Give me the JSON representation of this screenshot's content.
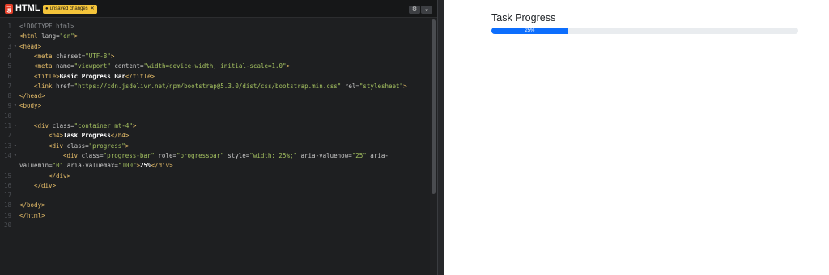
{
  "editor": {
    "language_label": "HTML",
    "unsaved_label": "unsaved changes",
    "unsaved_close": "✕",
    "settings_icon": "⚙",
    "collapse_icon": "⌄",
    "lines": [
      {
        "n": "1",
        "fold": "",
        "indent": 0,
        "tokens": [
          {
            "t": "<!DOCTYPE html>",
            "c": "doctype"
          }
        ]
      },
      {
        "n": "2",
        "fold": "",
        "indent": 0,
        "tokens": [
          {
            "t": "<",
            "c": "tag"
          },
          {
            "t": "html",
            "c": "tag"
          },
          {
            "t": " lang",
            "c": "attr"
          },
          {
            "t": "=",
            "c": "plain"
          },
          {
            "t": "\"en\"",
            "c": "str"
          },
          {
            "t": ">",
            "c": "tag"
          }
        ]
      },
      {
        "n": "3",
        "fold": "▾",
        "indent": 0,
        "tokens": [
          {
            "t": "<head>",
            "c": "tag"
          }
        ]
      },
      {
        "n": "4",
        "fold": "",
        "indent": 1,
        "tokens": [
          {
            "t": "<meta",
            "c": "tag"
          },
          {
            "t": " charset",
            "c": "attr"
          },
          {
            "t": "=",
            "c": "plain"
          },
          {
            "t": "\"UTF-8\"",
            "c": "str"
          },
          {
            "t": ">",
            "c": "tag"
          }
        ]
      },
      {
        "n": "5",
        "fold": "",
        "indent": 1,
        "tokens": [
          {
            "t": "<meta",
            "c": "tag"
          },
          {
            "t": " name",
            "c": "attr"
          },
          {
            "t": "=",
            "c": "plain"
          },
          {
            "t": "\"viewport\"",
            "c": "str"
          },
          {
            "t": " content",
            "c": "attr"
          },
          {
            "t": "=",
            "c": "plain"
          },
          {
            "t": "\"width=device-width, initial-scale=1.0\"",
            "c": "str"
          },
          {
            "t": ">",
            "c": "tag"
          }
        ]
      },
      {
        "n": "6",
        "fold": "",
        "indent": 1,
        "tokens": [
          {
            "t": "<title>",
            "c": "tag"
          },
          {
            "t": "Basic Progress Bar",
            "c": "text"
          },
          {
            "t": "</title>",
            "c": "tag"
          }
        ]
      },
      {
        "n": "7",
        "fold": "",
        "indent": 1,
        "tokens": [
          {
            "t": "<link",
            "c": "tag"
          },
          {
            "t": " href",
            "c": "attr"
          },
          {
            "t": "=",
            "c": "plain"
          },
          {
            "t": "\"https://cdn.jsdelivr.net/npm/bootstrap@5.3.0/dist/css/bootstrap.min.css\"",
            "c": "str"
          },
          {
            "t": " rel",
            "c": "attr"
          },
          {
            "t": "=",
            "c": "plain"
          },
          {
            "t": "\"stylesheet\"",
            "c": "str"
          },
          {
            "t": ">",
            "c": "tag"
          }
        ]
      },
      {
        "n": "8",
        "fold": "",
        "indent": 0,
        "tokens": [
          {
            "t": "</head>",
            "c": "tag"
          }
        ]
      },
      {
        "n": "9",
        "fold": "▾",
        "indent": 0,
        "tokens": [
          {
            "t": "<body>",
            "c": "tag"
          }
        ]
      },
      {
        "n": "10",
        "fold": "",
        "indent": 0,
        "tokens": []
      },
      {
        "n": "11",
        "fold": "▾",
        "indent": 1,
        "tokens": [
          {
            "t": "<div",
            "c": "tag"
          },
          {
            "t": " class",
            "c": "attr"
          },
          {
            "t": "=",
            "c": "plain"
          },
          {
            "t": "\"container mt-4\"",
            "c": "str"
          },
          {
            "t": ">",
            "c": "tag"
          }
        ]
      },
      {
        "n": "12",
        "fold": "",
        "indent": 2,
        "tokens": [
          {
            "t": "<h4>",
            "c": "tag"
          },
          {
            "t": "Task Progress",
            "c": "text"
          },
          {
            "t": "</h4>",
            "c": "tag"
          }
        ]
      },
      {
        "n": "13",
        "fold": "▾",
        "indent": 2,
        "tokens": [
          {
            "t": "<div",
            "c": "tag"
          },
          {
            "t": " class",
            "c": "attr"
          },
          {
            "t": "=",
            "c": "plain"
          },
          {
            "t": "\"progress\"",
            "c": "str"
          },
          {
            "t": ">",
            "c": "tag"
          }
        ]
      },
      {
        "n": "14",
        "fold": "▾",
        "indent": 3,
        "tokens": [
          {
            "t": "<div",
            "c": "tag"
          },
          {
            "t": " class",
            "c": "attr"
          },
          {
            "t": "=",
            "c": "plain"
          },
          {
            "t": "\"progress-bar\"",
            "c": "str"
          },
          {
            "t": " role",
            "c": "attr"
          },
          {
            "t": "=",
            "c": "plain"
          },
          {
            "t": "\"progressbar\"",
            "c": "str"
          },
          {
            "t": " style",
            "c": "attr"
          },
          {
            "t": "=",
            "c": "plain"
          },
          {
            "t": "\"width: 25%;\"",
            "c": "str"
          },
          {
            "t": " aria-valuenow",
            "c": "attr"
          },
          {
            "t": "=",
            "c": "plain"
          },
          {
            "t": "\"25\"",
            "c": "str"
          },
          {
            "t": " aria-",
            "c": "attr"
          }
        ]
      },
      {
        "n": "",
        "fold": "",
        "indent": 0,
        "tokens": [
          {
            "t": "valuemin",
            "c": "attr"
          },
          {
            "t": "=",
            "c": "plain"
          },
          {
            "t": "\"0\"",
            "c": "str"
          },
          {
            "t": " aria-valuemax",
            "c": "attr"
          },
          {
            "t": "=",
            "c": "plain"
          },
          {
            "t": "\"100\"",
            "c": "str"
          },
          {
            "t": ">",
            "c": "tag"
          },
          {
            "t": "25%",
            "c": "text"
          },
          {
            "t": "</div>",
            "c": "tag"
          }
        ]
      },
      {
        "n": "15",
        "fold": "",
        "indent": 2,
        "tokens": [
          {
            "t": "</div>",
            "c": "tag"
          }
        ]
      },
      {
        "n": "16",
        "fold": "",
        "indent": 1,
        "tokens": [
          {
            "t": "</div>",
            "c": "tag"
          }
        ]
      },
      {
        "n": "17",
        "fold": "",
        "indent": 0,
        "tokens": []
      },
      {
        "n": "18",
        "fold": "",
        "indent": 0,
        "tokens": [
          {
            "t": "</body>",
            "c": "tag"
          }
        ]
      },
      {
        "n": "19",
        "fold": "",
        "indent": 0,
        "tokens": [
          {
            "t": "</html>",
            "c": "tag"
          }
        ]
      },
      {
        "n": "20",
        "fold": "",
        "indent": 0,
        "tokens": []
      }
    ]
  },
  "syntax_colors": {
    "tag": "#e8bf6a",
    "attr": "#c8c8c8",
    "str": "#a5c261",
    "text": "#ffffff",
    "plain": "#c8c8c8",
    "doctype": "#8a8d91"
  },
  "preview": {
    "title": "Task Progress",
    "progress_label": "25%",
    "progress_fraction": 0.25,
    "progress_color": "#0d6efd",
    "track_color": "#e9ecef"
  }
}
